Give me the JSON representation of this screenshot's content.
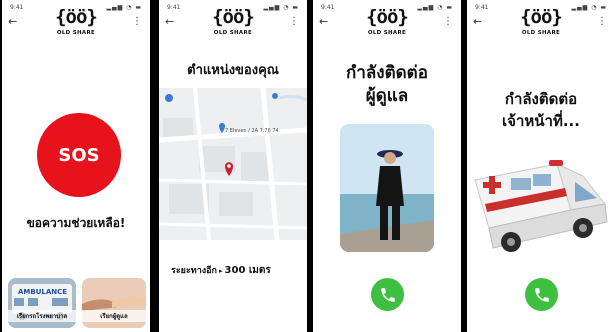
{
  "status_bar": {
    "time": "9:41",
    "icons": "▂▄▆ ◔ ▬"
  },
  "app": {
    "logo_mark": "{öö}",
    "logo_text": "OLD SHARE"
  },
  "screen_sos": {
    "sos_label": "SOS",
    "help_text": "ขอความช่วยเหลือ!",
    "tiles": [
      {
        "label": "เรียกรถโรงพยาบาล",
        "image_text": "AMBULANCE"
      },
      {
        "label": "เรียกผู้ดูแล"
      }
    ]
  },
  "screen_location": {
    "title": "ตำแหน่งของคุณ",
    "map_label": "7 Eleven / 2A 7.76 74",
    "distance_label": "ระยะทางอีก",
    "distance_value": "300 เมตร"
  },
  "screen_caregiver": {
    "title_line1": "กำลังติดต่อ",
    "title_line2": "ผู้ดูแล"
  },
  "screen_officer": {
    "title_line1": "กำลังติดต่อ",
    "title_line2": "เจ้าหน้าที่..."
  },
  "colors": {
    "sos_red": "#e8121c",
    "call_green": "#3fbf3f",
    "pin_red": "#d0222b",
    "pin_blue": "#3a7bd5"
  },
  "icons": {
    "back": "arrow-left-icon",
    "menu": "more-vertical-icon",
    "call": "phone-icon",
    "pin": "map-pin-icon"
  }
}
